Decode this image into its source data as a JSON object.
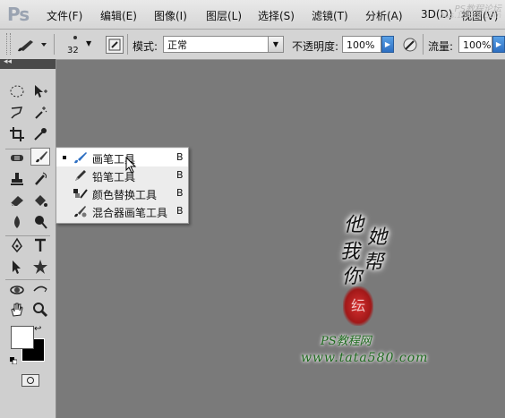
{
  "app": {
    "logo": "Ps"
  },
  "menu": [
    "文件(F)",
    "编辑(E)",
    "图像(I)",
    "图层(L)",
    "选择(S)",
    "滤镜(T)",
    "分析(A)",
    "3D(D)",
    "视图(V)"
  ],
  "watermark_top": {
    "line1": "PS教程论坛",
    "line2": "bbs.16xx8.com"
  },
  "options": {
    "brush_size": "32",
    "mode_label": "模式:",
    "mode_value": "正常",
    "opacity_label": "不透明度:",
    "opacity_value": "100%",
    "flow_label": "流量:",
    "flow_value": "100%"
  },
  "toolbar": {
    "collapse_glyph": "◂◂"
  },
  "flyout": {
    "items": [
      {
        "label": "画笔工具",
        "key": "B",
        "selected": true,
        "icon": "brush-icon"
      },
      {
        "label": "铅笔工具",
        "key": "B",
        "selected": false,
        "icon": "pencil-icon"
      },
      {
        "label": "颜色替换工具",
        "key": "B",
        "selected": false,
        "icon": "color-replacement-icon"
      },
      {
        "label": "混合器画笔工具",
        "key": "B",
        "selected": false,
        "icon": "mixer-brush-icon"
      }
    ]
  },
  "canvas_watermark": {
    "chars": [
      "他",
      "她",
      "我",
      "帮",
      "你"
    ],
    "seal": "纭",
    "title": "PS教程网",
    "url": "www.tata580.com"
  },
  "colors": {
    "canvas_bg": "#7a7a7a",
    "accent_blue": "#2d6fc2",
    "watermark_green": "#1e6a1e",
    "seal_red": "#a11818"
  }
}
